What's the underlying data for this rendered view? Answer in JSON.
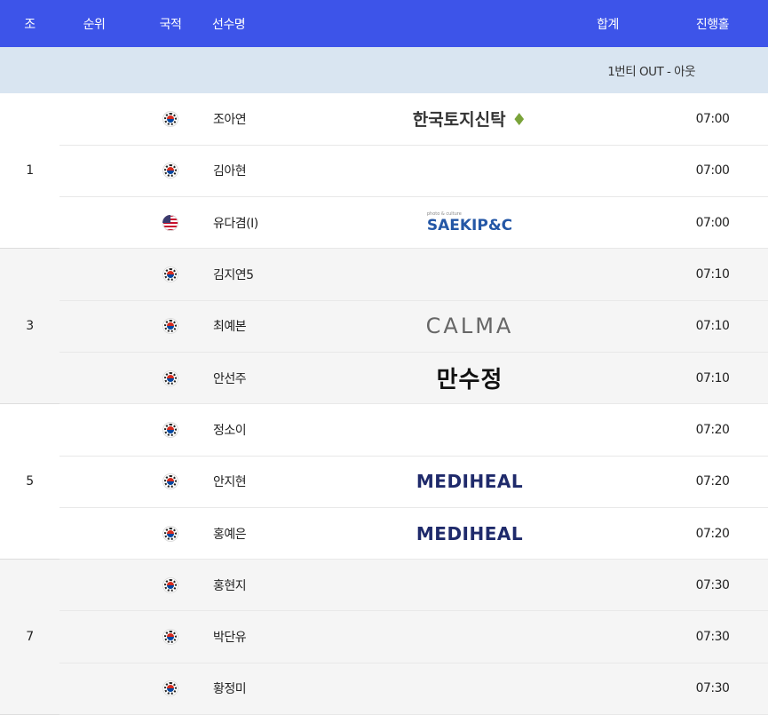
{
  "header": {
    "group": "조",
    "rank": "순위",
    "nation": "국적",
    "player": "선수명",
    "total": "합계",
    "hole": "진행홀"
  },
  "subheader": "1번티 OUT - 아웃",
  "groups": [
    {
      "group": "1",
      "players": [
        {
          "name": "조아연",
          "flag": "kr",
          "sponsor": "한국토지신탁",
          "hole": "07:00"
        },
        {
          "name": "김아현",
          "flag": "kr",
          "sponsor": "",
          "hole": "07:00"
        },
        {
          "name": "유다겸(I)",
          "flag": "us",
          "sponsor": "SAEKIP&C",
          "sponsor_tag": "photo & culture",
          "hole": "07:00"
        }
      ]
    },
    {
      "group": "3",
      "players": [
        {
          "name": "김지연5",
          "flag": "kr",
          "sponsor": "",
          "hole": "07:10"
        },
        {
          "name": "최예본",
          "flag": "kr",
          "sponsor": "CALMA",
          "hole": "07:10"
        },
        {
          "name": "안선주",
          "flag": "kr",
          "sponsor": "만수정",
          "hole": "07:10"
        }
      ]
    },
    {
      "group": "5",
      "players": [
        {
          "name": "정소이",
          "flag": "kr",
          "sponsor": "",
          "hole": "07:20"
        },
        {
          "name": "안지현",
          "flag": "kr",
          "sponsor": "MEDIHEAL",
          "hole": "07:20"
        },
        {
          "name": "홍예은",
          "flag": "kr",
          "sponsor": "MEDIHEAL",
          "hole": "07:20"
        }
      ]
    },
    {
      "group": "7",
      "players": [
        {
          "name": "홍현지",
          "flag": "kr",
          "sponsor": "",
          "hole": "07:30"
        },
        {
          "name": "박단유",
          "flag": "kr",
          "sponsor": "",
          "hole": "07:30"
        },
        {
          "name": "황정미",
          "flag": "kr",
          "sponsor": "",
          "hole": "07:30"
        }
      ]
    }
  ]
}
